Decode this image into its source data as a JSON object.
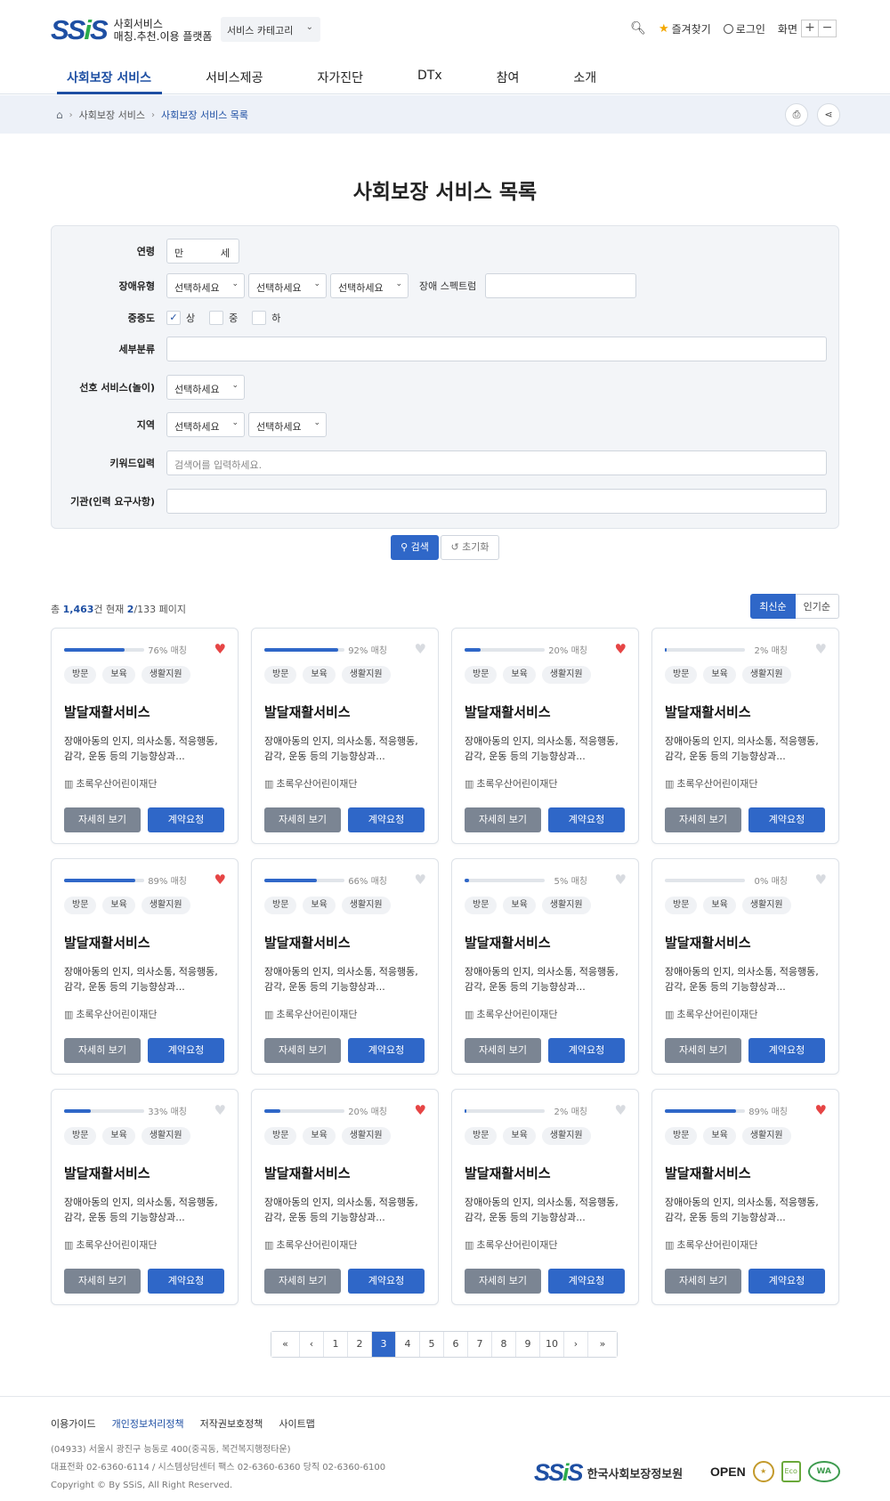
{
  "header": {
    "logo_mark": "SSiS",
    "logo_line1": "사회서비스",
    "logo_line2": "매칭.추천.이용 플랫폼",
    "category_select": "서비스 카테고리",
    "favorites": "즐겨찾기",
    "login": "로그인",
    "zoom_label": "화면",
    "zoom_in": "+",
    "zoom_out": "−"
  },
  "nav": [
    "사회보장 서비스",
    "서비스제공",
    "자가진단",
    "DTx",
    "참여",
    "소개"
  ],
  "breadcrumb": {
    "level1": "사회보장 서비스",
    "current": "사회보장 서비스 목록"
  },
  "page_title": "사회보장 서비스 목록",
  "filter": {
    "age_label": "연령",
    "age_prefix": "만",
    "age_suffix": "세",
    "disability_type_label": "장애유형",
    "select_placeholder": "선택하세요",
    "spectrum_label": "장애 스펙트럼",
    "severity_label": "중증도",
    "severity_options": [
      {
        "label": "상",
        "checked": true
      },
      {
        "label": "중",
        "checked": false
      },
      {
        "label": "하",
        "checked": false
      }
    ],
    "subcategory_label": "세부분류",
    "preferred_label": "선호 서비스(놀이)",
    "region_label": "지역",
    "keyword_label": "키워드입력",
    "keyword_placeholder": "검색어를 입력하세요.",
    "org_label": "기관(인력 요구사항)"
  },
  "actions": {
    "search": "검색",
    "reset": "초기화"
  },
  "summary": {
    "prefix": "총",
    "total": "1,463",
    "mid": "건 현재",
    "current": "2",
    "sep": "/",
    "pages": "133",
    "suffix": "페이지"
  },
  "sort": {
    "latest": "최신순",
    "popular": "인기순"
  },
  "cards": [
    {
      "match": 76,
      "match_label": "76% 매칭",
      "liked": true
    },
    {
      "match": 92,
      "match_label": "92% 매칭",
      "liked": false
    },
    {
      "match": 20,
      "match_label": "20% 매칭",
      "liked": true
    },
    {
      "match": 2,
      "match_label": "2% 매칭",
      "liked": false
    },
    {
      "match": 89,
      "match_label": "89% 매칭",
      "liked": true
    },
    {
      "match": 66,
      "match_label": "66% 매칭",
      "liked": false
    },
    {
      "match": 5,
      "match_label": "5% 매칭",
      "liked": false
    },
    {
      "match": 0,
      "match_label": "0% 매칭",
      "liked": false
    },
    {
      "match": 33,
      "match_label": "33% 매칭",
      "liked": false
    },
    {
      "match": 20,
      "match_label": "20% 매칭",
      "liked": true
    },
    {
      "match": 2,
      "match_label": "2% 매칭",
      "liked": false
    },
    {
      "match": 89,
      "match_label": "89% 매칭",
      "liked": true
    }
  ],
  "card_common": {
    "tags": [
      "방문",
      "보육",
      "생활지원"
    ],
    "title": "발달재활서비스",
    "desc": "장애아동의 인지, 의사소통, 적응행동, 감각, 운동 등의 기능향상과...",
    "org": "초록우산어린이재단",
    "detail": "자세히 보기",
    "contract": "계약요청"
  },
  "pagination": {
    "first": "«",
    "prev": "‹",
    "pages": [
      "1",
      "2",
      "3",
      "4",
      "5",
      "6",
      "7",
      "8",
      "9",
      "10"
    ],
    "current": "3",
    "next": "›",
    "last": "»"
  },
  "footer": {
    "links": [
      "이용가이드",
      "개인정보처리정책",
      "저작권보호정책",
      "사이트맵"
    ],
    "address": "(04933) 서울시 광진구 능동로 400(중곡동, 복건복지행정타운)",
    "phone": "대표전화 02-6360-6114 / 시스템상담센터   팩스 02-6360-6360   당직 02-6360-6100",
    "copyright": "Copyright © By SSiS, All Right Reserved.",
    "org_name": "한국사회보장정보원",
    "badge_open": "OPEN",
    "badge_eco": "Eco",
    "badge_wa": "WA"
  }
}
